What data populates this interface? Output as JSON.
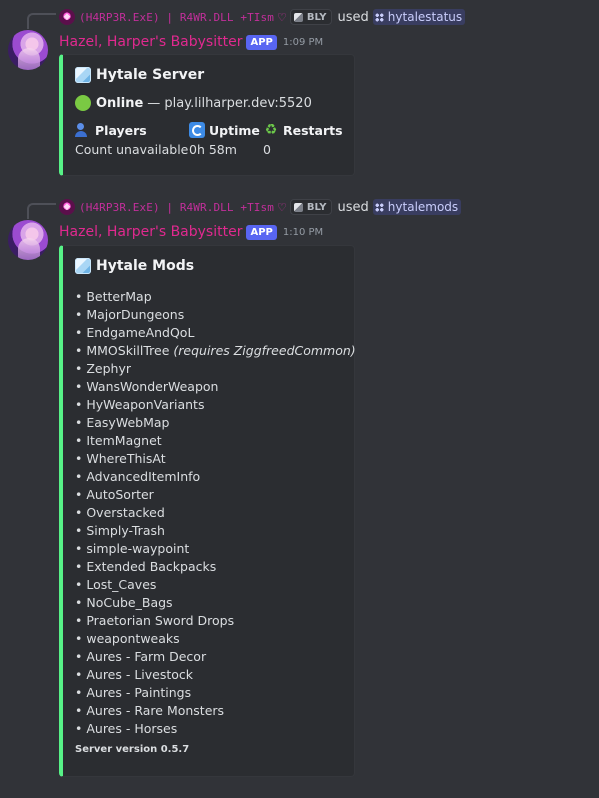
{
  "messages": [
    {
      "reply": {
        "user": "(H4RP3R.ExE) | R4WR.DLL +TIsm",
        "heart": "♡",
        "badge": "BLY",
        "used": "used",
        "command": "hytalestatus"
      },
      "author": "Hazel, Harper's Babysitter",
      "tag": "APP",
      "time": "1:09 PM",
      "embed": {
        "color": "#57f287",
        "title": "Hytale Server",
        "status_label": "Online",
        "status_rest": "— play.lilharper.dev:5520",
        "fields": {
          "players": {
            "name": "Players",
            "value": "Count unavailable"
          },
          "uptime": {
            "name": "Uptime",
            "value": "0h 58m"
          },
          "restarts": {
            "name": "Restarts",
            "value": "0"
          }
        }
      }
    },
    {
      "reply": {
        "user": "(H4RP3R.ExE) | R4WR.DLL +TIsm",
        "heart": "♡",
        "badge": "BLY",
        "used": "used",
        "command": "hytalemods"
      },
      "author": "Hazel, Harper's Babysitter",
      "tag": "APP",
      "time": "1:10 PM",
      "embed": {
        "color": "#57f287",
        "title": "Hytale Mods",
        "mods": [
          {
            "name": "• BetterMap"
          },
          {
            "name": "• MajorDungeons"
          },
          {
            "name": "• EndgameAndQoL"
          },
          {
            "name": "• MMOSkillTree",
            "note": "(requires ZiggfreedCommon)"
          },
          {
            "name": "• Zephyr"
          },
          {
            "name": "• WansWonderWeapon"
          },
          {
            "name": "• HyWeaponVariants"
          },
          {
            "name": "• EasyWebMap"
          },
          {
            "name": "• ItemMagnet"
          },
          {
            "name": "• WhereThisAt"
          },
          {
            "name": "• AdvancedItemInfo"
          },
          {
            "name": "• AutoSorter"
          },
          {
            "name": "• Overstacked"
          },
          {
            "name": "• Simply-Trash"
          },
          {
            "name": "• simple-waypoint"
          },
          {
            "name": "• Extended Backpacks"
          },
          {
            "name": "• Lost_Caves"
          },
          {
            "name": "• NoCube_Bags"
          },
          {
            "name": "• Praetorian Sword Drops"
          },
          {
            "name": "• weapontweaks"
          },
          {
            "name": "• Aures - Farm Decor"
          },
          {
            "name": "• Aures - Livestock"
          },
          {
            "name": "• Aures - Paintings"
          },
          {
            "name": "• Aures - Rare Monsters"
          },
          {
            "name": "• Aures - Horses"
          }
        ],
        "footer": "Server version 0.5.7"
      }
    }
  ],
  "icons": {
    "reply_avatar": "pink-avatar-icon",
    "badge": "bly-badge-icon",
    "command": "slash-command-icon",
    "embed_title": "ice-block-icon",
    "status": "green-circle-icon",
    "players": "busts-icon",
    "uptime": "refresh-icon",
    "restarts": "recycle-icon"
  }
}
